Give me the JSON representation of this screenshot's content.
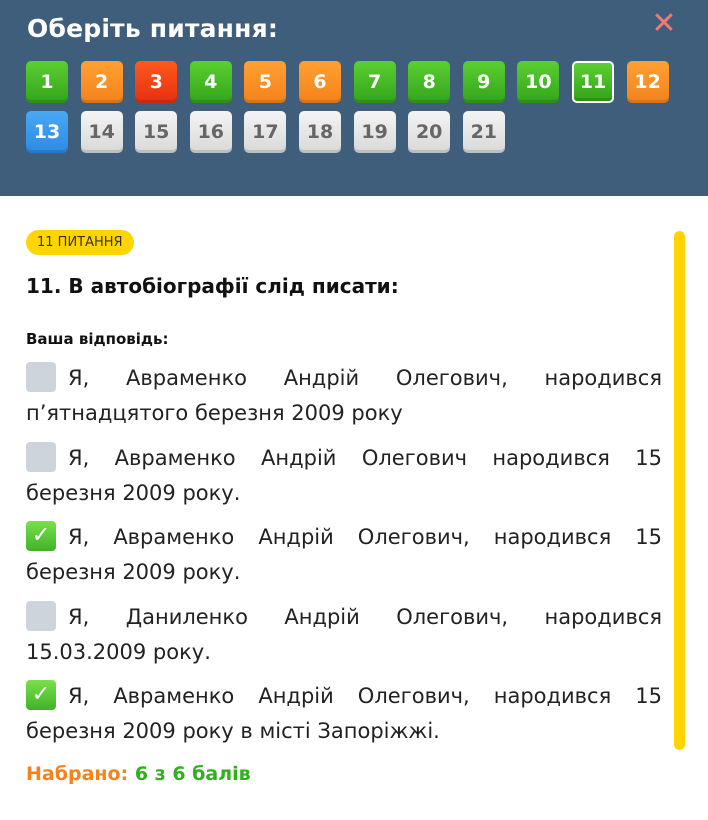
{
  "header": {
    "title": "Оберіть питання:",
    "close_icon": "close-icon",
    "close_symbol": "✕"
  },
  "questions": [
    {
      "label": "1",
      "state": "green"
    },
    {
      "label": "2",
      "state": "orange"
    },
    {
      "label": "3",
      "state": "red"
    },
    {
      "label": "4",
      "state": "green"
    },
    {
      "label": "5",
      "state": "orange"
    },
    {
      "label": "6",
      "state": "orange"
    },
    {
      "label": "7",
      "state": "green"
    },
    {
      "label": "8",
      "state": "green"
    },
    {
      "label": "9",
      "state": "green"
    },
    {
      "label": "10",
      "state": "green"
    },
    {
      "label": "11",
      "state": "current"
    },
    {
      "label": "12",
      "state": "orange"
    },
    {
      "label": "13",
      "state": "blue"
    },
    {
      "label": "14",
      "state": "gray"
    },
    {
      "label": "15",
      "state": "gray"
    },
    {
      "label": "16",
      "state": "gray"
    },
    {
      "label": "17",
      "state": "gray"
    },
    {
      "label": "18",
      "state": "gray"
    },
    {
      "label": "19",
      "state": "gray"
    },
    {
      "label": "20",
      "state": "gray"
    },
    {
      "label": "21",
      "state": "gray"
    }
  ],
  "question": {
    "badge": "11 ПИТАННЯ",
    "text": "11. В автобіографії слід писати:",
    "answer_label": "Ваша відповідь:",
    "options": [
      {
        "text": "Я, Авраменко Андрій Олегович, народився п’ятнадцятого березня 2009 року",
        "checked": false
      },
      {
        "text": "Я, Авраменко Андрій Олегович народився 15 березня 2009 року.",
        "checked": false
      },
      {
        "text": "Я, Авраменко Андрій Олегович, народився 15 березня 2009 року.",
        "checked": true
      },
      {
        "text": "Я, Даниленко Андрій Олегович, народився 15.03.2009 року.",
        "checked": false
      },
      {
        "text": "Я, Авраменко Андрій Олегович, народився 15 березня 2009 року в місті Запоріжжі.",
        "checked": true
      }
    ],
    "check_symbol": "✓"
  },
  "score": {
    "label": "Набрано:",
    "value": "6 з 6 балів"
  },
  "colors": {
    "header_bg": "#3f5e7b",
    "accent_yellow": "#ffd500",
    "correct_green": "#2fb01c",
    "score_orange": "#f5821a"
  }
}
